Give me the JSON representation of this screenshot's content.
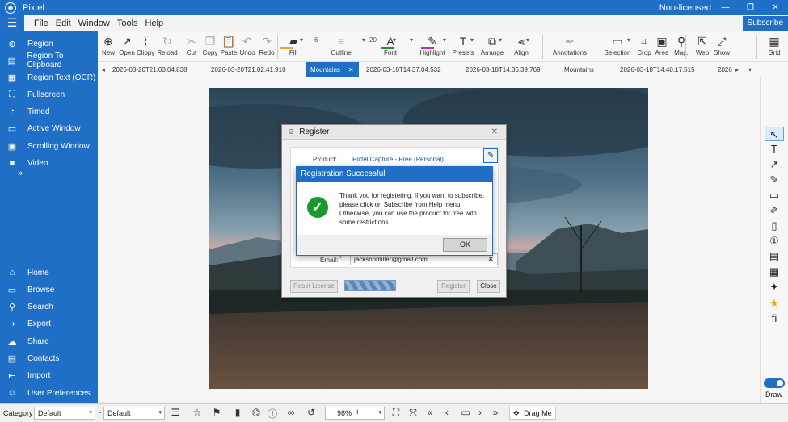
{
  "app": {
    "title": "Pixtel",
    "license_status": "Non-licensed",
    "window_buttons": [
      "—",
      "❐",
      "✕"
    ],
    "subscribe_label": "Subscribe"
  },
  "menu": [
    "File",
    "Edit",
    "Window",
    "Tools",
    "Help"
  ],
  "sidebar": {
    "capture_items": [
      {
        "label": "Region",
        "icon": "plus-circle-icon",
        "glyph": "⊕"
      },
      {
        "label": "Region To Clipboard",
        "icon": "clipboard-icon",
        "glyph": "▤"
      },
      {
        "label": "Region Text (OCR)",
        "icon": "ocr-icon",
        "glyph": "▦"
      },
      {
        "label": "Fullscreen",
        "icon": "fullscreen-icon",
        "glyph": "⛶"
      },
      {
        "label": "Timed",
        "icon": "timer-icon",
        "glyph": "◔"
      },
      {
        "label": "Active Window",
        "icon": "window-icon",
        "glyph": "▭"
      },
      {
        "label": "Scrolling Window",
        "icon": "scroll-window-icon",
        "glyph": "▣"
      },
      {
        "label": "Video",
        "icon": "video-icon",
        "glyph": "■"
      }
    ],
    "more_glyph": "»",
    "nav_items": [
      {
        "label": "Home",
        "icon": "home-icon",
        "glyph": "⌂"
      },
      {
        "label": "Browse",
        "icon": "browse-icon",
        "glyph": "▭"
      },
      {
        "label": "Search",
        "icon": "search-icon",
        "glyph": "⚲"
      },
      {
        "label": "Export",
        "icon": "export-icon",
        "glyph": "⇥"
      },
      {
        "label": "Share",
        "icon": "share-icon",
        "glyph": "☁"
      },
      {
        "label": "Contacts",
        "icon": "contacts-icon",
        "glyph": "▤"
      },
      {
        "label": "Import",
        "icon": "import-icon",
        "glyph": "⇤"
      },
      {
        "label": "User Preferences",
        "icon": "user-icon",
        "glyph": "☺"
      }
    ]
  },
  "toolbar": [
    {
      "label": "New",
      "icon": "new-icon",
      "glyph": "⊕",
      "dim": false
    },
    {
      "label": "Open",
      "icon": "open-icon",
      "glyph": "↗",
      "dim": false
    },
    {
      "label": "Clippy",
      "icon": "paperclip-icon",
      "glyph": "⌇",
      "dim": false
    },
    {
      "label": "Reload",
      "icon": "reload-icon",
      "glyph": "↻",
      "dim": true
    },
    {
      "label": "Cut",
      "icon": "cut-icon",
      "glyph": "✂",
      "dim": true
    },
    {
      "label": "Copy",
      "icon": "copy-icon",
      "glyph": "❐",
      "dim": true
    },
    {
      "label": "Paste",
      "icon": "paste-icon",
      "glyph": "📋",
      "dim": false
    },
    {
      "label": "Undo",
      "icon": "undo-icon",
      "glyph": "↶",
      "dim": true
    },
    {
      "label": "Redo",
      "icon": "redo-icon",
      "glyph": "↷",
      "dim": true
    },
    {
      "label": "Fill",
      "icon": "fill-icon",
      "glyph": "▰",
      "dim": false
    },
    {
      "label": "Outline",
      "icon": "outline-icon",
      "glyph": "≡",
      "dim": true
    },
    {
      "label": "Font",
      "icon": "font-icon",
      "glyph": "A",
      "dim": false
    },
    {
      "label": "Highlight",
      "icon": "highlight-icon",
      "glyph": "✎",
      "dim": false
    },
    {
      "label": "Presets",
      "icon": "presets-icon",
      "glyph": "T",
      "dim": false
    },
    {
      "label": "Arrange",
      "icon": "arrange-icon",
      "glyph": "⧉",
      "dim": false
    },
    {
      "label": "Align",
      "icon": "align-icon",
      "glyph": "⫷",
      "dim": false
    },
    {
      "label": "Annotations",
      "icon": "annotations-icon",
      "glyph": "✒",
      "dim": true
    },
    {
      "label": "Selection",
      "icon": "selection-icon",
      "glyph": "▭",
      "dim": false
    },
    {
      "label": "Crop",
      "icon": "crop-icon",
      "glyph": "⌗",
      "dim": false
    },
    {
      "label": "Area",
      "icon": "area-icon",
      "glyph": "▣",
      "dim": false
    },
    {
      "label": "Mag.",
      "icon": "magnify-icon",
      "glyph": "⚲",
      "dim": false
    },
    {
      "label": "Web",
      "icon": "web-icon",
      "glyph": "⇱",
      "dim": false
    },
    {
      "label": "Show",
      "icon": "show-icon",
      "glyph": "⤢",
      "dim": false
    },
    {
      "label": "Grid",
      "icon": "grid-icon",
      "glyph": "▦",
      "dim": false
    }
  ],
  "toolbar_values": {
    "outline_size": "6",
    "font_size": "20",
    "dropdown_glyph": "▾"
  },
  "tabs": [
    {
      "label": "2026-03-20T21.03.04.838",
      "active": false
    },
    {
      "label": "2026-03-20T21.02.41.910",
      "active": false
    },
    {
      "label": "Mountains",
      "active": true
    },
    {
      "label": "2026-03-18T14.37.04.532",
      "active": false
    },
    {
      "label": "2026-03-18T14.36.39.769",
      "active": false
    },
    {
      "label": "Mountains",
      "active": false
    },
    {
      "label": "2026-03-18T14.40.17.515",
      "active": false
    },
    {
      "label": "2026",
      "active": false
    }
  ],
  "tab_close_glyph": "✕",
  "tab_arrows": {
    "left": "◂",
    "right": "▸",
    "menu": "▾"
  },
  "right_tools": [
    {
      "name": "pointer-icon",
      "glyph": "↖",
      "selected": true
    },
    {
      "name": "text-tool-icon",
      "glyph": "T",
      "selected": false
    },
    {
      "name": "arrow-tool-icon",
      "glyph": "↗",
      "selected": false
    },
    {
      "name": "pen-tool-icon",
      "glyph": "✎",
      "selected": false
    },
    {
      "name": "rectangle-tool-icon",
      "glyph": "▭",
      "selected": false
    },
    {
      "name": "marker-tool-icon",
      "glyph": "✐",
      "selected": false
    },
    {
      "name": "note-tool-icon",
      "glyph": "▯",
      "selected": false
    },
    {
      "name": "step-number-icon",
      "glyph": "①",
      "selected": false
    },
    {
      "name": "stamp-tool-icon",
      "glyph": "▤",
      "selected": false
    },
    {
      "name": "blur-tool-icon",
      "glyph": "▦",
      "selected": false
    },
    {
      "name": "magic-tool-icon",
      "glyph": "✦",
      "selected": false
    },
    {
      "name": "star-tool-icon",
      "glyph": "★",
      "selected": false
    },
    {
      "name": "ligature-tool-icon",
      "glyph": "fi",
      "selected": false
    }
  ],
  "draw_label": "Draw",
  "statusbar": {
    "category_label": "Category",
    "category_value": "Default",
    "second_value": "Default",
    "dash": "-",
    "zoom": "98%",
    "drag_label": "Drag Me",
    "icons": [
      {
        "name": "details-icon",
        "glyph": "☰"
      },
      {
        "name": "favorite-star-icon",
        "glyph": "☆"
      },
      {
        "name": "flag-icon",
        "glyph": "⚑"
      },
      {
        "name": "bookmark-icon",
        "glyph": "▮"
      },
      {
        "name": "tag-icon",
        "glyph": "⌬"
      },
      {
        "name": "info-icon",
        "glyph": "ⓘ"
      },
      {
        "name": "link-icon",
        "glyph": "∞"
      },
      {
        "name": "history-icon",
        "glyph": "↺"
      }
    ],
    "zoom_controls": {
      "plus": "+",
      "minus": "−",
      "dropdown": "▾"
    },
    "view_icons": [
      {
        "name": "fit-icon",
        "glyph": "⛶"
      },
      {
        "name": "expand-icon",
        "glyph": "⤧"
      },
      {
        "name": "first-page-icon",
        "glyph": "«"
      },
      {
        "name": "prev-page-icon",
        "glyph": "‹"
      },
      {
        "name": "page-icon",
        "glyph": "▭"
      },
      {
        "name": "next-page-icon",
        "glyph": "›"
      },
      {
        "name": "last-page-icon",
        "glyph": "»"
      }
    ],
    "drag_glyph": "✥"
  },
  "register_dialog": {
    "title": "Register",
    "close_glyph": "✕",
    "product_label": "Product:",
    "product_value": "Pixtel Capture - Free (Personal)",
    "email_label": "Email:",
    "required_mark": "*",
    "email_value": "jacksonmiller@gmail.com",
    "clear_glyph": "✕",
    "edit_glyph": "✎",
    "reset_label": "Reset License",
    "register_label": "Register",
    "close_label": "Close"
  },
  "success_dialog": {
    "title": "Registration Successful",
    "message": "Thank you for registering. If you want to subscribe, please click on Subscribe from Help menu. Otherwise, you can use the product for free with some restrictions.",
    "check_glyph": "✓",
    "ok_label": "OK"
  },
  "colors": {
    "accent": "#1e6fc5",
    "success": "#1a9a2e",
    "fill_swatch": "#f0a030",
    "font_swatch": "#1a9a2e",
    "highlight_swatch": "#c030c0"
  }
}
